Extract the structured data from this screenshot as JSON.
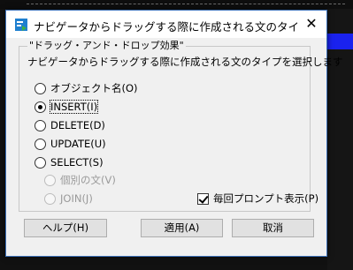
{
  "dialog": {
    "title": "ナビゲータからドラッグする際に作成される文のタイプを選...",
    "close_glyph": "✕"
  },
  "group": {
    "title": "\"ドラッグ・アンド・ドロップ効果\"",
    "description": "ナビゲータからドラッグする際に作成される文のタイプを選択します"
  },
  "options": [
    {
      "label": "オブジェクト名(O)",
      "checked": false,
      "enabled": true
    },
    {
      "label": "INSERT(I)",
      "checked": true,
      "enabled": true
    },
    {
      "label": "DELETE(D)",
      "checked": false,
      "enabled": true
    },
    {
      "label": "UPDATE(U)",
      "checked": false,
      "enabled": true
    },
    {
      "label": "SELECT(S)",
      "checked": false,
      "enabled": true
    },
    {
      "label": "個別の文(V)",
      "checked": false,
      "enabled": false
    },
    {
      "label": "JOIN(J)",
      "checked": false,
      "enabled": false
    }
  ],
  "prompt_checkbox": {
    "label": "毎回プロンプト表示(P)",
    "checked": true
  },
  "buttons": {
    "help": "ヘルプ(H)",
    "apply": "適用(A)",
    "cancel": "取消"
  },
  "colors": {
    "accent_blue": "#1a22ee",
    "title_border": "#3b6fb6",
    "dialog_bg": "#f0f0f0"
  }
}
